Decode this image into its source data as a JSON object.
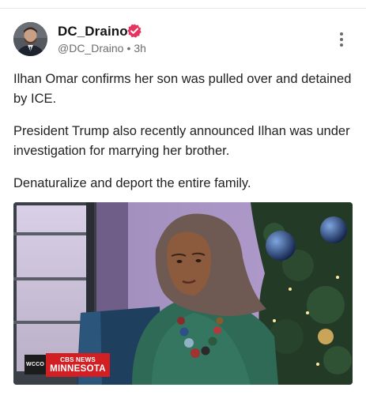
{
  "post": {
    "author": {
      "display_name": "DC_Draino",
      "handle": "@DC_Draino",
      "separator": "•",
      "time": "3h",
      "verified_icon": "verified-badge-icon",
      "verified_color": "#e5355e"
    },
    "menu_icon": "more-vertical-icon",
    "paragraphs": [
      "Ilhan Omar confirms her son was pulled over and detained by ICE.",
      "President Trump also recently announced Ilhan was under investigation for marrying her brother.",
      "Denaturalize and deport the entire family."
    ],
    "media": {
      "type": "video-still",
      "station_label": "WCCO",
      "network_line": "CBS NEWS",
      "network_region": "MINNESOTA",
      "network_color": "#d21f23"
    }
  }
}
